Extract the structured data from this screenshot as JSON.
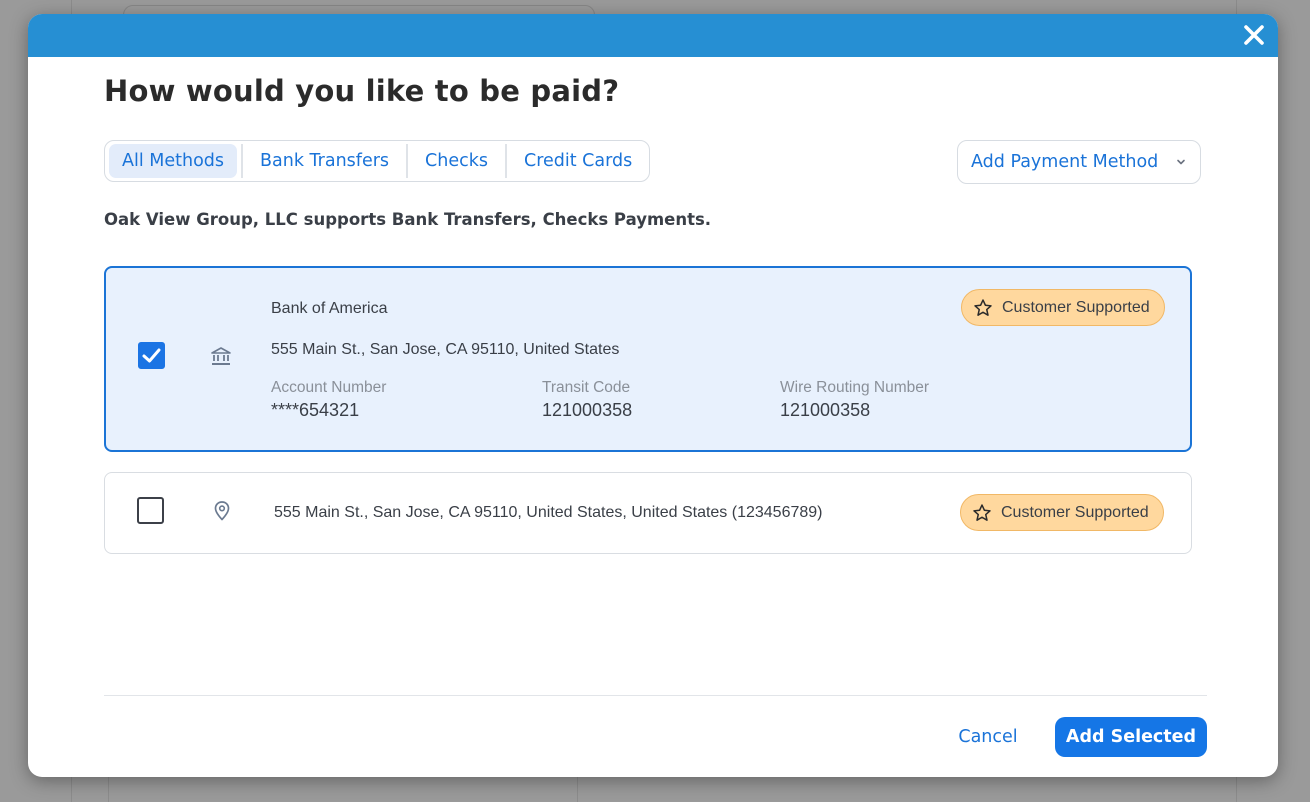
{
  "modal": {
    "title": "How would you like to be paid?",
    "close_icon": "close-icon",
    "header_color": "#268fd3"
  },
  "tabs": [
    {
      "label": "All Methods",
      "active": true
    },
    {
      "label": "Bank Transfers",
      "active": false
    },
    {
      "label": "Checks",
      "active": false
    },
    {
      "label": "Credit Cards",
      "active": false
    }
  ],
  "add_method": {
    "label": "Add Payment Method",
    "icon": "chevron-down-icon"
  },
  "support_note": "Oak View Group, LLC supports Bank Transfers, Checks Payments.",
  "methods": [
    {
      "type": "bank",
      "selected": true,
      "icon": "bank-icon",
      "name": "Bank of America",
      "address": "555 Main St., San Jose, CA 95110, United States",
      "badge": {
        "label": "Customer Supported",
        "icon": "star-icon"
      },
      "fields": [
        {
          "label": "Account Number",
          "value": "****654321"
        },
        {
          "label": "Transit Code",
          "value": "121000358"
        },
        {
          "label": "Wire Routing Number",
          "value": "121000358"
        }
      ]
    },
    {
      "type": "check",
      "selected": false,
      "icon": "location-pin-icon",
      "address": "555 Main St., San Jose, CA 95110, United States, United States (123456789)",
      "badge": {
        "label": "Customer Supported",
        "icon": "star-icon"
      }
    }
  ],
  "footer": {
    "cancel_label": "Cancel",
    "add_selected_label": "Add Selected"
  },
  "colors": {
    "accent": "#1576e6",
    "badge_bg": "#ffd89e",
    "selected_bg": "#e8f1fd"
  }
}
